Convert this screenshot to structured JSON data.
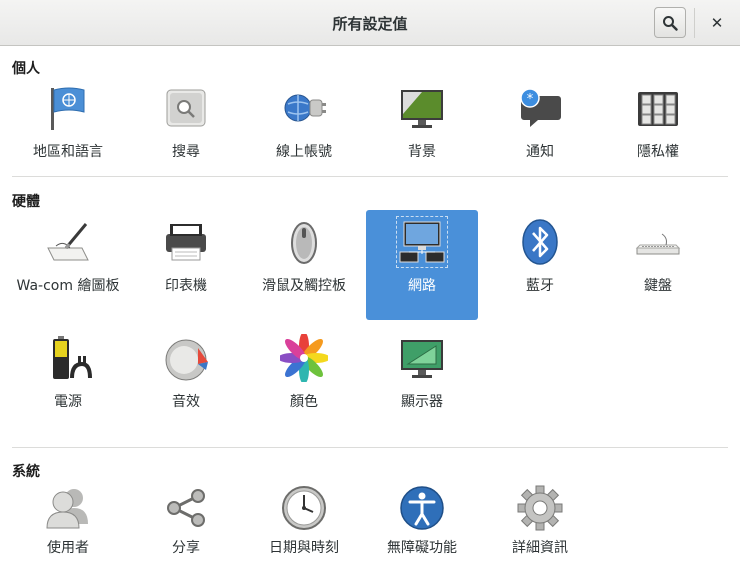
{
  "window": {
    "title": "所有設定值",
    "close_label": "✕"
  },
  "sections": {
    "personal": {
      "title": "個人",
      "items": [
        {
          "label": "地區和語言",
          "icon": "flag-icon"
        },
        {
          "label": "搜尋",
          "icon": "search-icon"
        },
        {
          "label": "線上帳號",
          "icon": "online-accounts-icon"
        },
        {
          "label": "背景",
          "icon": "background-icon"
        },
        {
          "label": "通知",
          "icon": "notification-icon"
        },
        {
          "label": "隱私權",
          "icon": "privacy-icon"
        }
      ]
    },
    "hardware": {
      "title": "硬體",
      "items": [
        {
          "label": "Wa-com 繪圖板",
          "icon": "tablet-icon"
        },
        {
          "label": "印表機",
          "icon": "printer-icon"
        },
        {
          "label": "滑鼠及觸控板",
          "icon": "mouse-icon"
        },
        {
          "label": "網路",
          "icon": "network-icon"
        },
        {
          "label": "藍牙",
          "icon": "bluetooth-icon"
        },
        {
          "label": "鍵盤",
          "icon": "keyboard-icon"
        },
        {
          "label": "電源",
          "icon": "battery-icon"
        },
        {
          "label": "音效",
          "icon": "sound-icon"
        },
        {
          "label": "顏色",
          "icon": "color-icon"
        },
        {
          "label": "顯示器",
          "icon": "display-icon"
        }
      ]
    },
    "system": {
      "title": "系統",
      "items": [
        {
          "label": "使用者",
          "icon": "users-icon"
        },
        {
          "label": "分享",
          "icon": "share-icon"
        },
        {
          "label": "日期與時刻",
          "icon": "clock-icon"
        },
        {
          "label": "無障礙功能",
          "icon": "accessibility-icon"
        },
        {
          "label": "詳細資訊",
          "icon": "gear-icon"
        }
      ]
    }
  },
  "selected_item": "網路",
  "colors": {
    "selection": "#4a90d9",
    "titlebar": "#ececeb"
  }
}
